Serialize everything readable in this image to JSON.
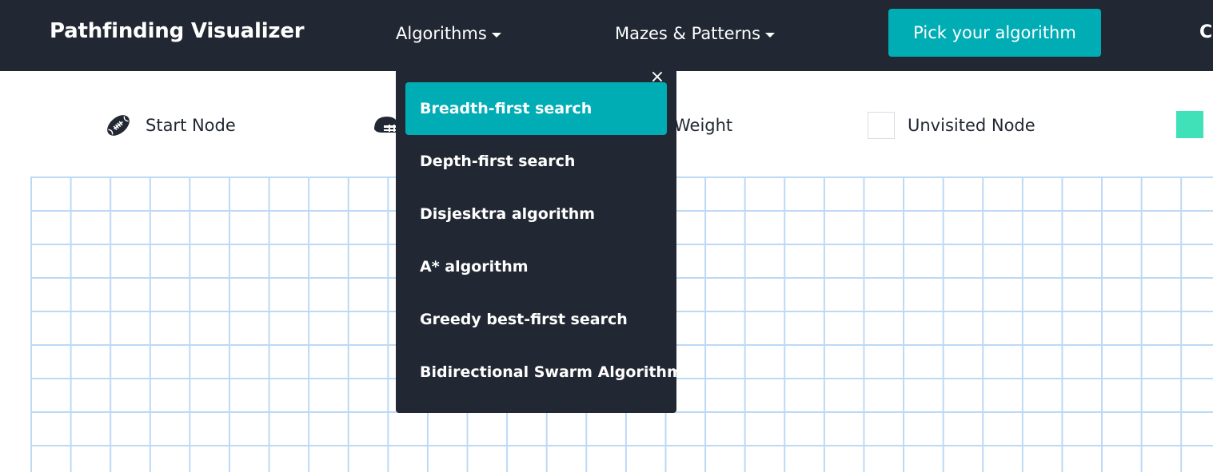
{
  "navbar": {
    "brand": "Pathfinding Visualizer",
    "algorithms_label": "Algorithms",
    "mazes_label": "Mazes & Patterns",
    "pick_button_label": "Pick your algorithm",
    "cut_item_label": "C"
  },
  "legend": {
    "start_node": "Start Node",
    "weight": "Weight",
    "unvisited_node": "Unvisited Node"
  },
  "dropdown": {
    "close_symbol": "×",
    "items": [
      {
        "label": "Breadth-first search",
        "active": true
      },
      {
        "label": "Depth-first search"
      },
      {
        "label": "Disjesktra algorithm"
      },
      {
        "label": "A* algorithm"
      },
      {
        "label": "Greedy best-first search"
      },
      {
        "label": "Bidirectional Swarm Algorithm"
      }
    ]
  },
  "colors": {
    "navbar": "#222833",
    "accent": "#00adb5",
    "grid_line": "#bcd9f5",
    "visited": "#40e0b8"
  },
  "icons": {
    "start": "football-icon",
    "target": "helmet-icon"
  }
}
